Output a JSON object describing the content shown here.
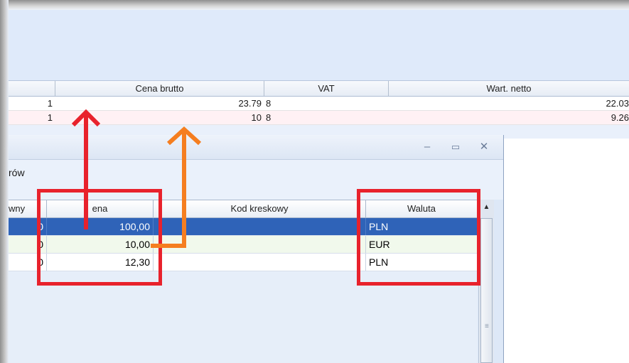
{
  "main_table": {
    "headers": [
      "Cena brutto",
      "VAT",
      "Wart. netto"
    ],
    "rows": [
      {
        "qty": "1",
        "gross_price": "23.79",
        "vat": "8",
        "net_value": "22.03"
      },
      {
        "qty": "1",
        "gross_price": "10",
        "vat": "8",
        "net_value": "9.26"
      }
    ]
  },
  "child_window": {
    "menu_label": "rów",
    "controls": {
      "minimize": "–",
      "maximize": "▭",
      "close": "✕"
    },
    "grid": {
      "headers": [
        "wny",
        "ena",
        "Kod kreskowy",
        "Waluta"
      ],
      "rows": [
        {
          "stock": "0",
          "price": "100,00",
          "barcode": "",
          "currency": "PLN"
        },
        {
          "stock": "0",
          "price": "10,00",
          "barcode": "",
          "currency": "EUR"
        },
        {
          "stock": "0",
          "price": "12,30",
          "barcode": "",
          "currency": "PLN"
        }
      ]
    },
    "scrollbar": {
      "up_icon": "▲",
      "grip": "≡"
    }
  },
  "annotations": {
    "highlight_color": "#e8222c",
    "arrow_red_color": "#e8222c",
    "arrow_orange_color": "#f57e20"
  }
}
